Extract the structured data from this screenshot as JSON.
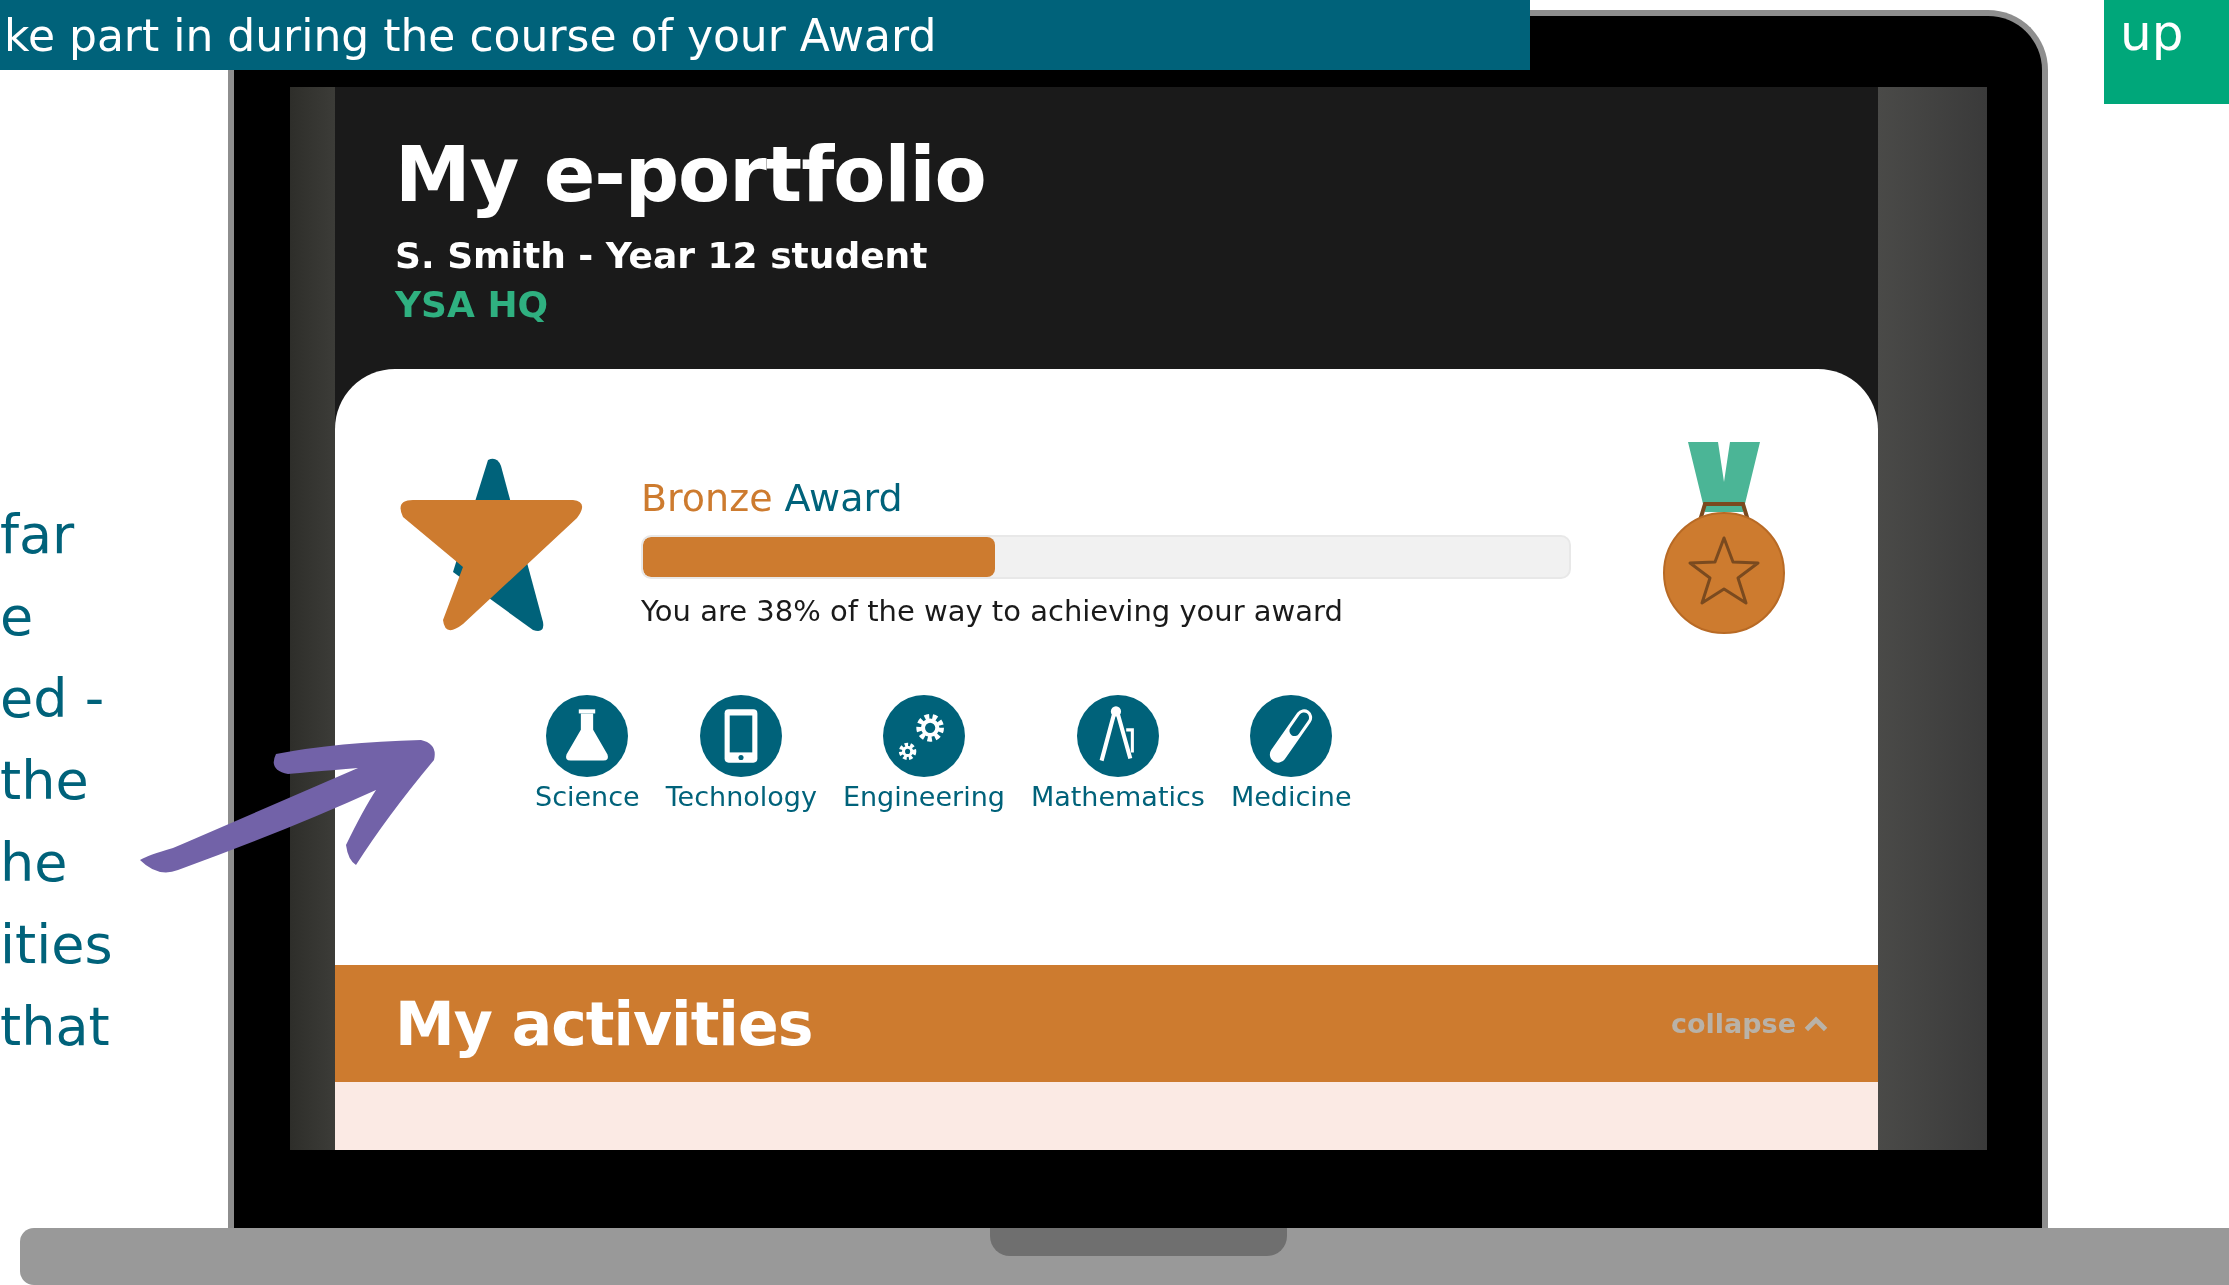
{
  "slide": {
    "banner": "ke part in during the course of your Award",
    "corner_text": "up",
    "side_text": [
      "far",
      "e",
      "ed -",
      "the",
      "he",
      "ities",
      "that"
    ]
  },
  "portfolio": {
    "title": "My e-portfolio",
    "subtitle": "S. Smith - Year 12 student",
    "centre": "YSA HQ",
    "award": {
      "level_name": "Bronze",
      "word": "Award",
      "level": 0.38,
      "caption": "You are 38% of the way to achieving your award"
    },
    "subjects": [
      {
        "label": "Science",
        "kind": "flask"
      },
      {
        "label": "Technology",
        "kind": "tablet"
      },
      {
        "label": "Engineering",
        "kind": "gears"
      },
      {
        "label": "Mathematics",
        "kind": "compass"
      },
      {
        "label": "Medicine",
        "kind": "pill"
      }
    ],
    "section": {
      "title": "My activities",
      "action": "collapse"
    }
  }
}
